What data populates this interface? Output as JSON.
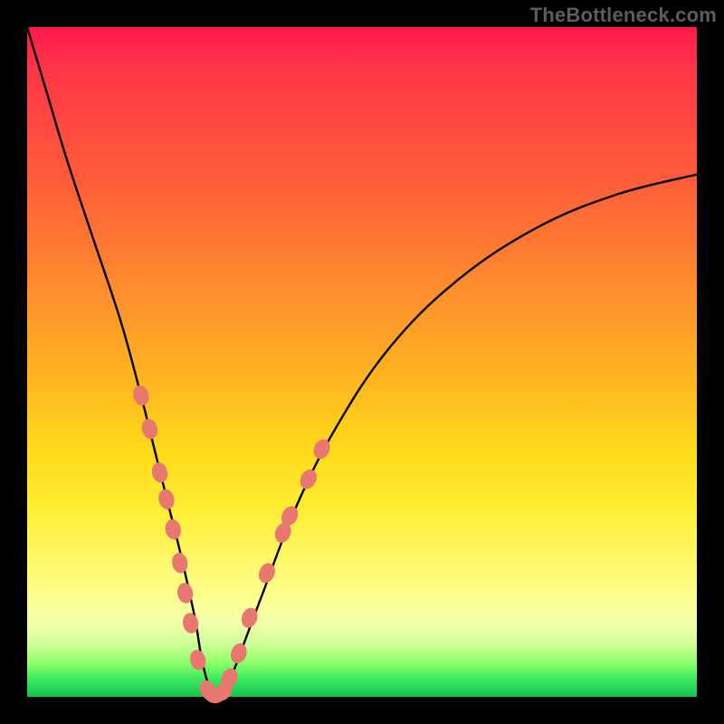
{
  "watermark": "TheBottleneck.com",
  "chart_data": {
    "type": "line",
    "title": "",
    "xlabel": "",
    "ylabel": "",
    "xlim": [
      0,
      100
    ],
    "ylim": [
      0,
      100
    ],
    "grid": false,
    "legend": false,
    "series": [
      {
        "name": "bottleneck-curve",
        "x": [
          0,
          3,
          6,
          10,
          14,
          17,
          19,
          21,
          23,
          25,
          26,
          27,
          28,
          30,
          32,
          35,
          40,
          46,
          54,
          64,
          76,
          88,
          100
        ],
        "y": [
          100,
          90,
          80,
          68,
          56,
          45,
          37,
          29,
          21,
          12,
          6,
          2,
          0,
          2,
          7,
          15,
          28,
          40,
          52,
          62,
          70,
          75,
          78
        ]
      }
    ],
    "markers": {
      "name": "highlight-dots",
      "color": "#e87770",
      "points": [
        {
          "x": 17.0,
          "y": 45.0
        },
        {
          "x": 18.3,
          "y": 40.0
        },
        {
          "x": 19.8,
          "y": 33.5
        },
        {
          "x": 20.8,
          "y": 29.5
        },
        {
          "x": 21.8,
          "y": 25.0
        },
        {
          "x": 22.8,
          "y": 20.0
        },
        {
          "x": 23.6,
          "y": 15.5
        },
        {
          "x": 24.4,
          "y": 11.0
        },
        {
          "x": 25.5,
          "y": 5.5
        },
        {
          "x": 27.0,
          "y": 1.0
        },
        {
          "x": 28.0,
          "y": 0.2
        },
        {
          "x": 29.3,
          "y": 0.8
        },
        {
          "x": 30.2,
          "y": 2.8
        },
        {
          "x": 31.6,
          "y": 6.5
        },
        {
          "x": 33.2,
          "y": 11.8
        },
        {
          "x": 35.8,
          "y": 18.5
        },
        {
          "x": 38.2,
          "y": 24.5
        },
        {
          "x": 39.2,
          "y": 27.0
        },
        {
          "x": 42.0,
          "y": 32.5
        },
        {
          "x": 44.0,
          "y": 37.0
        }
      ]
    }
  }
}
